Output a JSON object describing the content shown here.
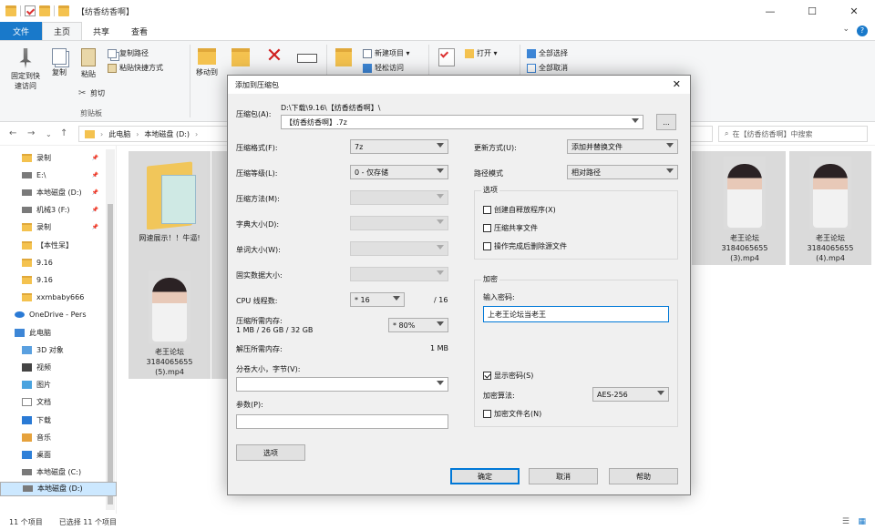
{
  "window": {
    "title": "【纺香纺香啊】",
    "controls": [
      "—",
      "☐",
      "✕"
    ]
  },
  "ribbon_tabs": [
    "文件",
    "主页",
    "共享",
    "查看"
  ],
  "ribbon": {
    "pin_label": "固定到快\n速访问",
    "copy_label": "复制",
    "paste_label": "粘贴",
    "copy_path": "复制路径",
    "paste_shortcut": "粘贴快捷方式",
    "cut": "剪切",
    "clipboard_group": "剪贴板",
    "move_to": "移动到",
    "new_item": "新建项目 ▾",
    "easy_access": "轻松访问",
    "open": "打开 ▾",
    "select_all": "全部选择",
    "select_none": "全部取消"
  },
  "address": {
    "path": [
      "此电脑",
      "本地磁盘 (D:)"
    ],
    "search_placeholder": "在【纺香纺香啊】中搜索"
  },
  "sidebar": [
    {
      "label": "录制",
      "icon": "folder",
      "pinned": true
    },
    {
      "label": "E:\\",
      "icon": "drive",
      "pinned": true
    },
    {
      "label": "本地磁盘 (D:)",
      "icon": "drive",
      "pinned": true
    },
    {
      "label": "机械3 (F:)",
      "icon": "drive",
      "pinned": true
    },
    {
      "label": "录制",
      "icon": "folder",
      "pinned": true
    },
    {
      "label": "【本性呆】",
      "icon": "folder",
      "pinned": false
    },
    {
      "label": "9.16",
      "icon": "folder",
      "pinned": false
    },
    {
      "label": "9.16",
      "icon": "folder",
      "pinned": false
    },
    {
      "label": "xxmbaby666",
      "icon": "folder",
      "pinned": false
    },
    {
      "label": "OneDrive - Pers",
      "icon": "onedrive",
      "pinned": false
    },
    {
      "label": "此电脑",
      "icon": "pc",
      "pinned": false
    },
    {
      "label": "3D 对象",
      "icon": "folder3d",
      "pinned": false
    },
    {
      "label": "视频",
      "icon": "video",
      "pinned": false
    },
    {
      "label": "图片",
      "icon": "picture",
      "pinned": false
    },
    {
      "label": "文档",
      "icon": "doc",
      "pinned": false
    },
    {
      "label": "下载",
      "icon": "download",
      "pinned": false
    },
    {
      "label": "音乐",
      "icon": "music",
      "pinned": false
    },
    {
      "label": "桌面",
      "icon": "desktop",
      "pinned": false
    },
    {
      "label": "本地磁盘 (C:)",
      "icon": "drive",
      "pinned": false
    },
    {
      "label": "本地磁盘 (D:)",
      "icon": "drive",
      "pinned": false,
      "selected": true
    }
  ],
  "files": [
    {
      "name": "网速展示！！牛逼!",
      "kind": "folder"
    },
    {
      "name": "老王论坛\n3184065655\n(3).mp4",
      "kind": "video"
    },
    {
      "name": "老王论坛\n3184065655\n(4).mp4",
      "kind": "video"
    },
    {
      "name": "老王论坛\n3184065655\n(5).mp4",
      "kind": "video"
    }
  ],
  "status": {
    "count": "11 个项目",
    "selected": "已选择 11 个项目"
  },
  "dialog": {
    "title": "添加到压缩包",
    "archive_label": "压缩包(A):",
    "archive_dir": "D:\\下载\\9.16\\【纺香纺香啊】\\",
    "archive_name": "【纺香纺香啊】.7z",
    "browse": "...",
    "format_label": "压缩格式(F):",
    "format_value": "7z",
    "level_label": "压缩等级(L):",
    "level_value": "0 - 仅存储",
    "method_label": "压缩方法(M):",
    "dict_label": "字典大小(D):",
    "word_label": "单词大小(W):",
    "solid_label": "固实数据大小:",
    "threads_label": "CPU 线程数:",
    "threads_value": "* 16",
    "threads_total": "/ 16",
    "mem_label": "压缩所需内存:",
    "mem_detail": "1 MB / 26 GB / 32 GB",
    "mem_value": "* 80%",
    "decomp_label": "解压所需内存:",
    "decomp_value": "1 MB",
    "split_label": "分卷大小，字节(V):",
    "params_label": "参数(P):",
    "options_button": "选项",
    "update_label": "更新方式(U):",
    "update_value": "添加并替换文件",
    "pathmode_label": "路径模式",
    "pathmode_value": "相对路径",
    "options_group": "选项",
    "opt_sfx": "创建自释放程序(X)",
    "opt_shared": "压缩共享文件",
    "opt_delete": "操作完成后删除源文件",
    "encrypt_group": "加密",
    "password_label": "输入密码:",
    "password_value": "上老王论坛当老王",
    "show_password": "显示密码(S)",
    "encrypt_method_label": "加密算法:",
    "encrypt_method_value": "AES-256",
    "encrypt_names": "加密文件名(N)",
    "ok": "确定",
    "cancel": "取消",
    "help": "帮助"
  }
}
